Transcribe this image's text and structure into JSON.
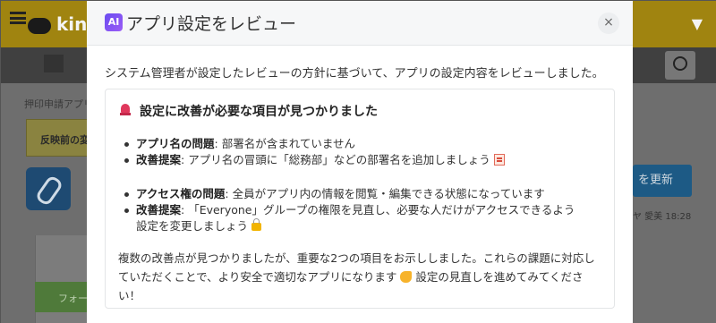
{
  "background": {
    "logo_text": "kint",
    "breadcrumb": "押印申請アプリ",
    "warning_text": "反映前の変",
    "update_button": "を更新",
    "meta": "ヤ 愛美  18:28",
    "form_button": "フォー"
  },
  "modal": {
    "ai_badge": "AI",
    "title": "アプリ設定をレビュー",
    "close_label": "×",
    "intro": "システム管理者が設定したレビューの方針に基づいて、アプリの設定内容をレビューしました。",
    "heading": "設定に改善が必要な項目が見つかりました",
    "group1": {
      "problem_label": "アプリ名の問題",
      "problem_text": ": 部署名が含まれていません",
      "suggestion_label": "改善提案",
      "suggestion_text": ": アプリ名の冒頭に「総務部」などの部署名を追加しましょう"
    },
    "group2": {
      "problem_label": "アクセス権の問題",
      "problem_text": ": 全員がアプリ内の情報を閲覧・編集できる状態になっています",
      "suggestion_label": "改善提案",
      "suggestion_text_line1": ": 「Everyone」グループの権限を見直し、必要な人だけがアクセスできるよう",
      "suggestion_text_line2": "設定を変更しましょう"
    },
    "summary_line1": "複数の改善点が見つかりましたが、重要な2つの項目をお示ししました。これらの課題に対応し",
    "summary_line2_a": "ていただくことで、より安全で適切なアプリになります",
    "summary_line2_b": "設定の見直しを進めてみてくださ",
    "summary_line3": "い！"
  },
  "icons": {
    "alert": "rotating-light-icon",
    "memo": "memo-icon",
    "lock": "lock-icon",
    "muscle": "flexed-biceps-icon",
    "close": "close-icon"
  },
  "colors": {
    "ai_gradient_start": "#6a4cf0",
    "ai_gradient_end": "#9b5cf6",
    "alert_red": "#e0385c"
  }
}
